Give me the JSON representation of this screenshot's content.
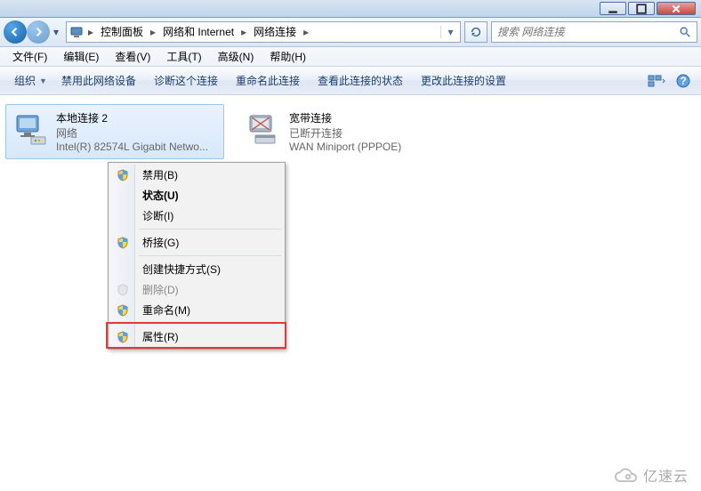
{
  "breadcrumb": {
    "root_icon": "computer-icon",
    "items": [
      "控制面板",
      "网络和 Internet",
      "网络连接"
    ]
  },
  "search": {
    "placeholder": "搜索 网络连接"
  },
  "menubar": [
    "文件(F)",
    "编辑(E)",
    "查看(V)",
    "工具(T)",
    "高级(N)",
    "帮助(H)"
  ],
  "toolbar": {
    "organize": "组织",
    "actions": [
      "禁用此网络设备",
      "诊断这个连接",
      "重命名此连接",
      "查看此连接的状态",
      "更改此连接的设置"
    ]
  },
  "connections": [
    {
      "name": "本地连接 2",
      "status": "网络",
      "device": "Intel(R) 82574L Gigabit Netwo...",
      "selected": true
    },
    {
      "name": "宽带连接",
      "status": "已断开连接",
      "device": "WAN Miniport (PPPOE)",
      "selected": false
    }
  ],
  "contextmenu": {
    "items": [
      {
        "label": "禁用(B)",
        "shield": true
      },
      {
        "label": "状态(U)",
        "bold": true
      },
      {
        "label": "诊断(I)"
      },
      {
        "sep": true
      },
      {
        "label": "桥接(G)",
        "shield": true
      },
      {
        "sep": true
      },
      {
        "label": "创建快捷方式(S)"
      },
      {
        "label": "删除(D)",
        "shield": true,
        "disabled": true
      },
      {
        "label": "重命名(M)",
        "shield": true
      },
      {
        "sep": true
      },
      {
        "label": "属性(R)",
        "shield": true
      }
    ]
  },
  "watermark": "亿速云"
}
